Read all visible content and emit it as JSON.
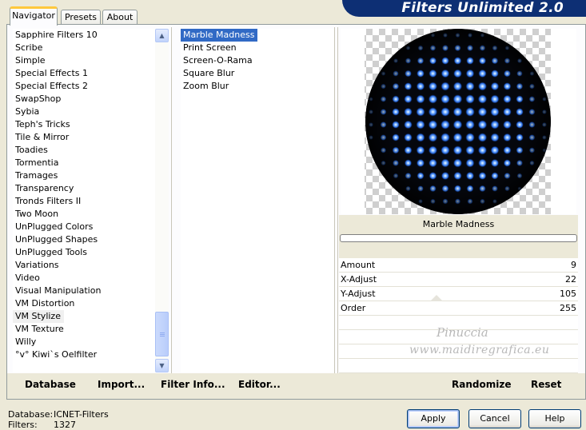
{
  "tabs": [
    {
      "label": "Navigator",
      "active": true
    },
    {
      "label": "Presets",
      "active": false
    },
    {
      "label": "About",
      "active": false
    }
  ],
  "banner": {
    "title": "Filters Unlimited 2.0",
    "color": "#0d2f74"
  },
  "categories": [
    "Sapphire Filters 10",
    "Scribe",
    "Simple",
    "Special Effects 1",
    "Special Effects 2",
    "SwapShop",
    "Sybia",
    "Teph's Tricks",
    "Tile & Mirror",
    "Toadies",
    "Tormentia",
    "Tramages",
    "Transparency",
    "Tronds Filters II",
    "Two Moon",
    "UnPlugged Colors",
    "UnPlugged Shapes",
    "UnPlugged Tools",
    "Variations",
    "Video",
    "Visual Manipulation",
    "VM Distortion",
    "VM Stylize",
    "VM Texture",
    "Willy",
    "°v° Kiwi`s Oelfilter"
  ],
  "selected_category": "VM Stylize",
  "filters": [
    "Marble Madness",
    "Print Screen",
    "Screen-O-Rama",
    "Square Blur",
    "Zoom Blur"
  ],
  "selected_filter": "Marble Madness",
  "preview": {
    "filter_name": "Marble Madness",
    "progress": 0
  },
  "params": [
    {
      "label": "Amount",
      "value": "9"
    },
    {
      "label": "X-Adjust",
      "value": "22"
    },
    {
      "label": "Y-Adjust",
      "value": "105"
    },
    {
      "label": "Order",
      "value": "255"
    }
  ],
  "watermark": {
    "line1": "Pinuccia",
    "line2": "www.maidiregrafica.eu"
  },
  "toolbar": {
    "database": "Database",
    "import": "Import...",
    "filter_info": "Filter Info...",
    "editor": "Editor...",
    "randomize": "Randomize",
    "reset": "Reset"
  },
  "footer": {
    "database_label": "Database:",
    "database_value": "ICNET-Filters",
    "filters_label": "Filters:",
    "filters_value": "1327"
  },
  "buttons": {
    "apply": "Apply",
    "cancel": "Cancel",
    "help": "Help"
  },
  "colors": {
    "selection": "#316ac5",
    "dot": "#3c8cff"
  }
}
